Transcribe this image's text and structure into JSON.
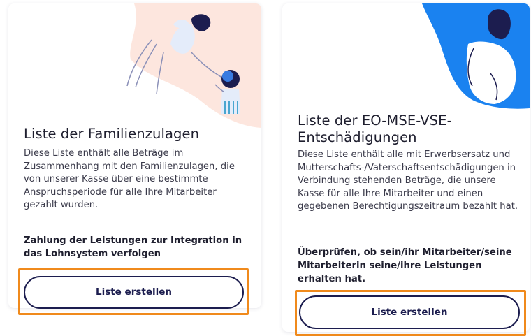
{
  "cards": [
    {
      "title": "Liste der Familienzulagen",
      "description": "Diese Liste enthält alle Beträge im Zusammenhang mit den Familienzulagen, die von unserer Kasse über eine bestimmte Anspruchsperiode für alle Ihre Mitarbeiter gezahlt wurden.",
      "cta": "Zahlung der Leistungen zur Integration in das Lohnsystem verfolgen",
      "button_label": "Liste erstellen",
      "illustration": "family-illustration",
      "accent_color": "#fde6de"
    },
    {
      "title": "Liste der EO-MSE-VSE-Entschädigungen",
      "description": "Diese Liste enthält alle mit Erwerbsersatz und Mutterschafts-/Vaterschaftsentschädigungen in Verbindung stehenden Beträge, die unsere Kasse für alle Ihre Mitarbeiter und einen gegebenen Berechtigungszeitraum bezahlt hat.",
      "cta": "Überprüfen, ob sein/ihr Mitarbeiter/seine Mitarbeiterin seine/ihre Leistungen erhalten hat.",
      "button_label": "Liste erstellen",
      "illustration": "pregnant-woman-illustration",
      "accent_color": "#1a82f0"
    }
  ],
  "highlight_color": "#f08a1c",
  "button_color": "#1c1d4f"
}
